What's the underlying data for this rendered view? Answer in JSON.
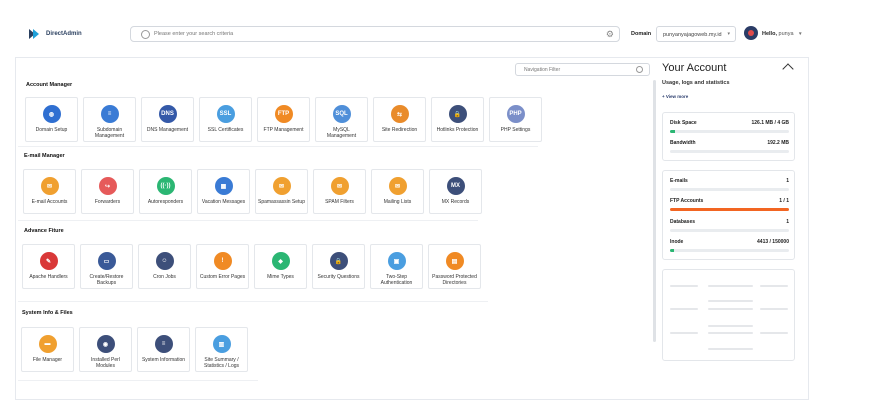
{
  "app": {
    "logo_text": "DirectAdmin"
  },
  "search": {
    "placeholder": "Please enter your search criteria"
  },
  "header": {
    "domain_label": "Domain",
    "domain_value": "punyanyajagoweb.my.id",
    "hello_label": "Hello,",
    "username": "punya"
  },
  "nav_filter": {
    "placeholder": "Navigation Filter"
  },
  "sections": [
    {
      "title": "Account Manager",
      "items": [
        {
          "label": "Domain Setup",
          "icon": "globe-icon",
          "color": "#2f6fd1"
        },
        {
          "label": "Subdomain Management",
          "icon": "server-icon",
          "color": "#3a7bd5"
        },
        {
          "label": "DNS Management",
          "icon": "dns-icon",
          "color": "#3459a8"
        },
        {
          "label": "SSL Certificates",
          "icon": "ssl-icon",
          "color": "#4a9ee0"
        },
        {
          "label": "FTP Management",
          "icon": "ftp-icon",
          "color": "#f08a24"
        },
        {
          "label": "MySQL Management",
          "icon": "sql-icon",
          "color": "#4f8fd9"
        },
        {
          "label": "Site Redirection",
          "icon": "signpost-icon",
          "color": "#e98b2a"
        },
        {
          "label": "Hotlinks Protection",
          "icon": "lock-icon",
          "color": "#3d4f7a"
        },
        {
          "label": "PHP Settings",
          "icon": "php-icon",
          "color": "#7b8fc9"
        }
      ]
    },
    {
      "title": "E-mail Manager",
      "items": [
        {
          "label": "E-mail Accounts",
          "icon": "envelope-icon",
          "color": "#f0a030"
        },
        {
          "label": "Forwarders",
          "icon": "forward-icon",
          "color": "#e65a5a"
        },
        {
          "label": "Autoresponders",
          "icon": "broadcast-icon",
          "color": "#2bb673"
        },
        {
          "label": "Vacation Messages",
          "icon": "calendar-icon",
          "color": "#3a7bd5"
        },
        {
          "label": "Spamassassin Setup",
          "icon": "envelope-icon",
          "color": "#f0a030"
        },
        {
          "label": "SPAM Filters",
          "icon": "envelope-icon",
          "color": "#f0a030"
        },
        {
          "label": "Mailing Lists",
          "icon": "envelope-icon",
          "color": "#f0a030"
        },
        {
          "label": "MX Records",
          "icon": "mx-icon",
          "color": "#3d4f7a"
        }
      ]
    },
    {
      "title": "Advance Fiture",
      "items": [
        {
          "label": "Apache Handlers",
          "icon": "feather-icon",
          "color": "#d93838"
        },
        {
          "label": "Create/Restore Backups",
          "icon": "computers-icon",
          "color": "#3a5a98"
        },
        {
          "label": "Cron Jobs",
          "icon": "robot-icon",
          "color": "#3d4f7a"
        },
        {
          "label": "Custom Error Pages",
          "icon": "error-page-icon",
          "color": "#f08a24"
        },
        {
          "label": "Mime Types",
          "icon": "mime-icon",
          "color": "#2bb673"
        },
        {
          "label": "Security Questions",
          "icon": "lock-icon",
          "color": "#3d4f7a"
        },
        {
          "label": "Two-Step Authentication",
          "icon": "monitor-icon",
          "color": "#4a9ee0"
        },
        {
          "label": "Password Protected Directories",
          "icon": "folder-lock-icon",
          "color": "#f08a24"
        }
      ]
    },
    {
      "title": "System Info & Files",
      "items": [
        {
          "label": "File Manager",
          "icon": "folder-icon",
          "color": "#f0a030"
        },
        {
          "label": "Installed Perl Modules",
          "icon": "perl-icon",
          "color": "#3d4f7a"
        },
        {
          "label": "System Information",
          "icon": "server-icon",
          "color": "#3d4f7a"
        },
        {
          "label": "Site Summary / Statistics / Logs",
          "icon": "document-icon",
          "color": "#4a9ee0"
        }
      ]
    }
  ],
  "sidebar": {
    "title": "Your Account",
    "subtitle": "Usage, logs and statistics",
    "view_more": "+ View more",
    "stats_group1": [
      {
        "label": "Disk Space",
        "value": "126.1 MB / 4 GB",
        "fraction": 0.04,
        "color": "#2bb673"
      },
      {
        "label": "Bandwidth",
        "value": "192.2 MB",
        "fraction": 0,
        "color": "#2bb673"
      }
    ],
    "stats_group2": [
      {
        "label": "E-mails",
        "value": "1",
        "fraction": 0,
        "color": "#2bb673"
      },
      {
        "label": "FTP Accounts",
        "value": "1 / 1",
        "fraction": 1.0,
        "color": "#f26522"
      },
      {
        "label": "Databases",
        "value": "1",
        "fraction": 0,
        "color": "#2bb673"
      },
      {
        "label": "Inode",
        "value": "4413 / 150000",
        "fraction": 0.03,
        "color": "#2bb673"
      }
    ]
  }
}
